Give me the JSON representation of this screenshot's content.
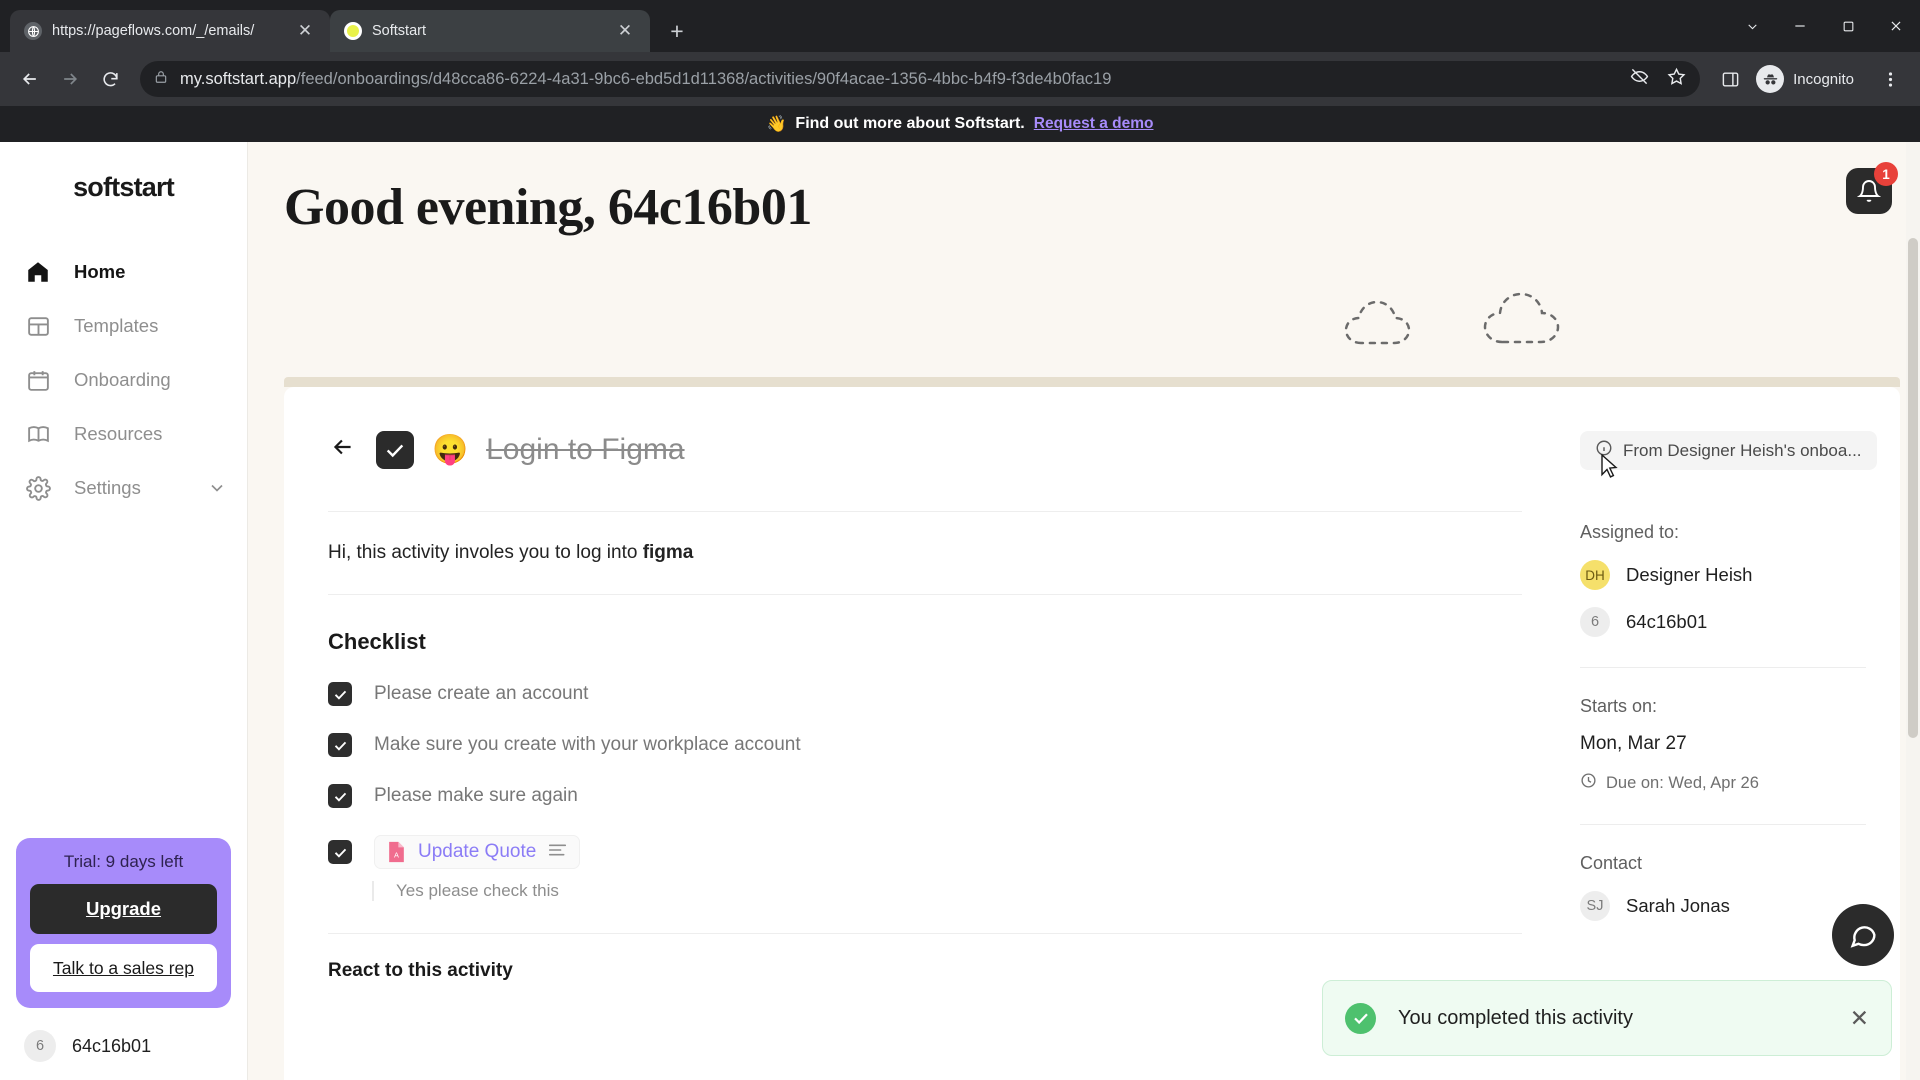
{
  "browser": {
    "tabs": [
      {
        "title": "https://pageflows.com/_/emails/",
        "favicon": "globe-icon",
        "active": false
      },
      {
        "title": "Softstart",
        "favicon": "softstart-icon",
        "active": true
      }
    ],
    "new_tab_label": "+",
    "close_label": "✕",
    "url_host": "my.softstart.app",
    "url_path": "/feed/onboardings/d48cca86-6224-4a31-9bc6-ebd5d1d11368/activities/90f4acae-1356-4bbc-b4f9-f3de4b0fac19",
    "profile_label": "Incognito"
  },
  "promo": {
    "emoji": "👋",
    "text": "Find out more about Softstart.",
    "link": "Request a demo"
  },
  "sidebar": {
    "logo": "softstart",
    "items": [
      {
        "label": "Home",
        "icon": "home-icon",
        "active": true
      },
      {
        "label": "Templates",
        "icon": "layout-icon",
        "active": false
      },
      {
        "label": "Onboarding",
        "icon": "calendar-icon",
        "active": false
      },
      {
        "label": "Resources",
        "icon": "book-icon",
        "active": false
      },
      {
        "label": "Settings",
        "icon": "gear-icon",
        "active": false,
        "chevron": true
      }
    ],
    "trial": {
      "label": "Trial: 9 days left",
      "upgrade": "Upgrade",
      "sales": "Talk to a sales rep",
      "accent": "#a78bfa"
    },
    "user": {
      "initials": "6",
      "name": "64c16b01"
    }
  },
  "main": {
    "greeting": "Good evening, 64c16b01",
    "notifications": {
      "count": "1",
      "icon": "bell-icon"
    },
    "activity": {
      "back_icon": "arrow-left-icon",
      "completed": true,
      "emoji": "😛",
      "title": "Login to Figma",
      "description_prefix": "Hi, this activity involes you to log into ",
      "description_bold": "figma",
      "checklist_title": "Checklist",
      "checklist": [
        {
          "text": "Please create an account",
          "checked": true,
          "type": "text"
        },
        {
          "text": "Make sure you create with your workplace account",
          "checked": true,
          "type": "text"
        },
        {
          "text": "Please make sure again",
          "checked": true,
          "type": "text"
        },
        {
          "text": "Update Quote",
          "checked": true,
          "type": "attachment",
          "file_icon": "pdf-icon",
          "note": "Yes please check this"
        }
      ],
      "react_title": "React to this activity"
    },
    "details": {
      "from_chip": "From Designer Heish's onboa...",
      "assigned_label": "Assigned to:",
      "assignees": [
        {
          "initials": "DH",
          "name": "Designer Heish",
          "color": "#f5e06b"
        },
        {
          "initials": "6",
          "name": "64c16b01",
          "color": "#ededed"
        }
      ],
      "starts_label": "Starts on:",
      "starts_value": "Mon, Mar 27",
      "due_value": "Due on: Wed, Apr 26",
      "contact_label": "Contact",
      "contacts": [
        {
          "initials": "SJ",
          "name": "Sarah Jonas"
        }
      ]
    },
    "toast": {
      "message": "You completed this activity",
      "close": "✕",
      "icon": "check-circle-icon",
      "color": "#4ec16e"
    },
    "chat": {
      "icon": "chat-icon"
    }
  }
}
